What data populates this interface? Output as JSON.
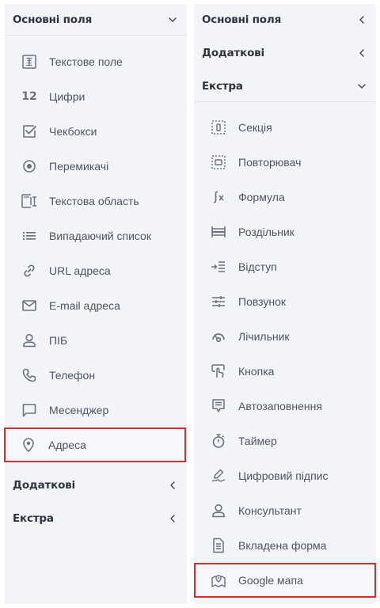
{
  "left_panel": {
    "sections": {
      "basic": {
        "title": "Основні поля",
        "state": "expanded"
      },
      "additional": {
        "title": "Додаткові",
        "state": "collapsed"
      },
      "extra": {
        "title": "Екстра",
        "state": "collapsed"
      }
    },
    "basic_fields": [
      {
        "label": "Текстове поле",
        "icon": "text-field-icon"
      },
      {
        "label": "Цифри",
        "icon": "numbers-icon",
        "glyph": "12"
      },
      {
        "label": "Чекбокси",
        "icon": "checkbox-icon"
      },
      {
        "label": "Перемикачі",
        "icon": "radio-icon"
      },
      {
        "label": "Текстова область",
        "icon": "textarea-icon"
      },
      {
        "label": "Випадаючий список",
        "icon": "dropdown-list-icon"
      },
      {
        "label": "URL адреса",
        "icon": "link-icon"
      },
      {
        "label": "E-mail адреса",
        "icon": "mail-icon"
      },
      {
        "label": "ПІБ",
        "icon": "person-icon"
      },
      {
        "label": "Телефон",
        "icon": "phone-icon"
      },
      {
        "label": "Месенджер",
        "icon": "chat-icon"
      },
      {
        "label": "Адреса",
        "icon": "location-pin-icon",
        "selected": true
      }
    ]
  },
  "right_panel": {
    "sections": {
      "basic": {
        "title": "Основні поля",
        "state": "collapsed"
      },
      "additional": {
        "title": "Додаткові",
        "state": "collapsed"
      },
      "extra": {
        "title": "Екстра",
        "state": "expanded"
      }
    },
    "extra_fields": [
      {
        "label": "Секція",
        "icon": "section-icon"
      },
      {
        "label": "Повторювач",
        "icon": "repeater-icon"
      },
      {
        "label": "Формула",
        "icon": "formula-icon"
      },
      {
        "label": "Роздільник",
        "icon": "divider-icon"
      },
      {
        "label": "Відступ",
        "icon": "indent-icon"
      },
      {
        "label": "Повзунок",
        "icon": "slider-icon"
      },
      {
        "label": "Лічильник",
        "icon": "counter-icon"
      },
      {
        "label": "Кнопка",
        "icon": "button-click-icon"
      },
      {
        "label": "Автозаповнення",
        "icon": "autocomplete-icon"
      },
      {
        "label": "Таймер",
        "icon": "timer-icon"
      },
      {
        "label": "Цифровий підпис",
        "icon": "signature-icon"
      },
      {
        "label": "Консультант",
        "icon": "consultant-icon"
      },
      {
        "label": "Вкладена форма",
        "icon": "nested-form-icon"
      },
      {
        "label": "Google мапа",
        "icon": "map-icon",
        "selected": true
      }
    ]
  },
  "colors": {
    "panel_bg": "#f3f4f7",
    "icon": "#6b7280",
    "selection_outline": "#d32f2f"
  }
}
